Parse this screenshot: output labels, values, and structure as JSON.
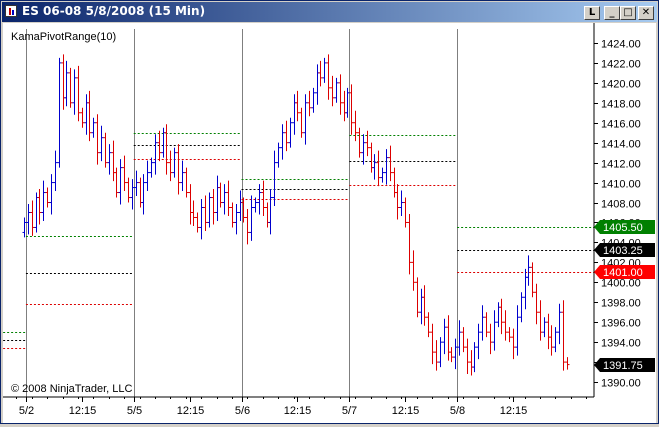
{
  "window": {
    "title": "ES 06-08  5/8/2008 (15 Min)",
    "buttons": {
      "help": "L",
      "minimize": "_",
      "maximize": "□",
      "close": "✕"
    }
  },
  "chart": {
    "indicator_label": "KamaPivotRange(10)",
    "copyright": "© 2008 NinjaTrader, LLC"
  },
  "colors": {
    "up_bar": "#0000cd",
    "down_bar": "#dc0000",
    "pivot_high": "#008000",
    "pivot_mid": "#000000",
    "pivot_low": "#dc0000",
    "badge_green": "#008000",
    "badge_black": "#000000",
    "badge_red": "#ff0000"
  },
  "chart_data": {
    "type": "ohlc",
    "y_ticks": [
      1390,
      1392,
      1394,
      1396,
      1398,
      1400,
      1402,
      1404,
      1406,
      1408,
      1410,
      1412,
      1414,
      1416,
      1418,
      1420,
      1422,
      1424
    ],
    "y_tick_labels": [
      "1390.00",
      "1392.00",
      "1394.00",
      "1396.00",
      "1398.00",
      "1400.00",
      "1402.00",
      "1404.00",
      "1406.00",
      "1408.00",
      "1410.00",
      "1412.00",
      "1414.00",
      "1416.00",
      "1418.00",
      "1420.00",
      "1422.00",
      "1424.00"
    ],
    "ylim": [
      1388.5,
      1426
    ],
    "x_tick_labels": [
      "5/2",
      "12:15",
      "5/5",
      "12:15",
      "5/6",
      "12:15",
      "5/7",
      "12:15",
      "5/8",
      "12:15"
    ],
    "session_starts": [
      1,
      29,
      57,
      85,
      113
    ],
    "n_bars": 150,
    "price_badges": [
      {
        "label": "1405.50",
        "value": 1405.5,
        "style": "green"
      },
      {
        "label": "1403.25",
        "value": 1403.25,
        "style": "black"
      },
      {
        "label": "1401.00",
        "value": 1401.0,
        "style": "red"
      },
      {
        "label": "1391.75",
        "value": 1391.75,
        "style": "black"
      }
    ],
    "pivots": [
      {
        "start": -7,
        "end": 0,
        "high": 1395.0,
        "mid": 1394.2,
        "low": 1393.4
      },
      {
        "start": 1,
        "end": 28,
        "high": 1404.6,
        "mid": 1400.9,
        "low": 1397.8
      },
      {
        "start": 29,
        "end": 56,
        "high": 1415.0,
        "mid": 1413.8,
        "low": 1412.4
      },
      {
        "start": 57,
        "end": 84,
        "high": 1410.4,
        "mid": 1409.4,
        "low": 1408.4
      },
      {
        "start": 85,
        "end": 112,
        "high": 1414.8,
        "mid": 1412.2,
        "low": 1409.8
      },
      {
        "start": 113,
        "end": 149,
        "high": 1405.5,
        "mid": 1403.25,
        "low": 1401.0
      }
    ],
    "close": [
      1406.0,
      1407.0,
      1405.5,
      1408.5,
      1407.0,
      1409.0,
      1408.0,
      1410.0,
      1412.0,
      1422.0,
      1418.5,
      1421.0,
      1418.0,
      1420.5,
      1417.0,
      1416.0,
      1418.0,
      1415.0,
      1416.0,
      1413.0,
      1414.5,
      1412.0,
      1413.0,
      1411.0,
      1409.0,
      1411.5,
      1410.0,
      1408.5,
      1409.5,
      1410.0,
      1408.0,
      1410.0,
      1411.0,
      1412.0,
      1414.0,
      1413.0,
      1415.0,
      1412.0,
      1411.0,
      1413.0,
      1410.0,
      1411.0,
      1409.0,
      1407.0,
      1406.5,
      1405.5,
      1407.5,
      1406.0,
      1408.5,
      1407.0,
      1409.5,
      1408.0,
      1409.0,
      1407.5,
      1406.0,
      1407.0,
      1408.0,
      1406.5,
      1405.0,
      1407.5,
      1408.0,
      1409.0,
      1407.5,
      1406.0,
      1408.5,
      1412.0,
      1413.5,
      1415.0,
      1414.0,
      1416.0,
      1418.0,
      1417.0,
      1415.0,
      1418.0,
      1417.5,
      1419.0,
      1421.0,
      1420.5,
      1422.0,
      1419.5,
      1418.5,
      1420.0,
      1418.0,
      1417.0,
      1419.0,
      1416.0,
      1415.0,
      1413.0,
      1414.0,
      1413.5,
      1411.5,
      1412.0,
      1410.5,
      1411.0,
      1412.5,
      1411.0,
      1409.0,
      1407.5,
      1408.0,
      1406.0,
      1402.0,
      1400.0,
      1397.0,
      1398.5,
      1396.5,
      1395.0,
      1393.0,
      1392.0,
      1394.0,
      1395.5,
      1393.0,
      1392.5,
      1393.5,
      1395.0,
      1393.5,
      1392.0,
      1391.5,
      1393.5,
      1395.0,
      1396.5,
      1395.0,
      1394.0,
      1396.0,
      1397.5,
      1396.0,
      1395.0,
      1394.5,
      1393.5,
      1396.5,
      1398.5,
      1400.5,
      1401.5,
      1399.0,
      1397.0,
      1395.0,
      1396.0,
      1394.5,
      1393.5,
      1395.0,
      1397.0,
      1392.0,
      1391.75
    ]
  }
}
